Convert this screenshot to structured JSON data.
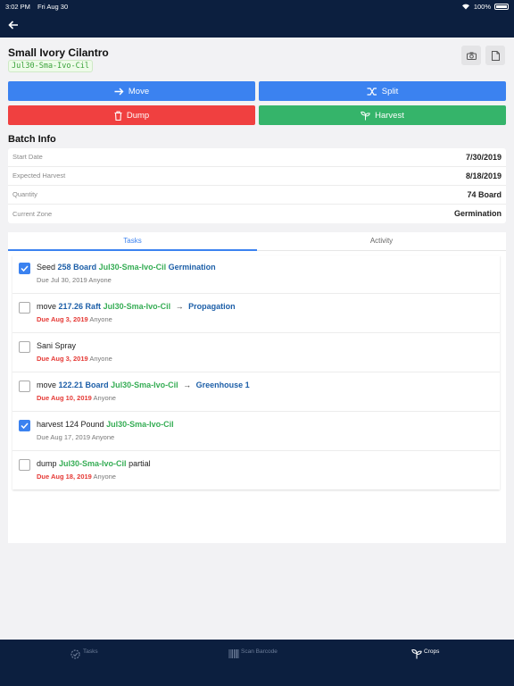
{
  "status": {
    "time": "3:02 PM",
    "date": "Fri Aug 30",
    "battery": "100%"
  },
  "header": {
    "title": "Small Ivory Cilantro",
    "code": "Jul30-Sma-Ivo-Cil"
  },
  "actions": {
    "move": "Move",
    "split": "Split",
    "dump": "Dump",
    "harvest": "Harvest"
  },
  "batch_info": {
    "title": "Batch Info",
    "rows": [
      {
        "label": "Start Date",
        "value": "7/30/2019"
      },
      {
        "label": "Expected Harvest",
        "value": "8/18/2019"
      },
      {
        "label": "Quantity",
        "value": "74 Board"
      },
      {
        "label": "Current Zone",
        "value": "Germination"
      }
    ]
  },
  "tabs": {
    "tasks": "Tasks",
    "activity": "Activity"
  },
  "tasks": [
    {
      "checked": true,
      "verb": "Seed",
      "qty": "258 Board",
      "code": "Jul30-Sma-Ivo-Cil",
      "arrow": "",
      "dest": "Germination",
      "suffix": "",
      "due": "Due Jul 30, 2019",
      "overdue": false,
      "assignee": "Anyone"
    },
    {
      "checked": false,
      "verb": "move",
      "qty": "217.26 Raft",
      "code": "Jul30-Sma-Ivo-Cil",
      "arrow": "→",
      "dest": "Propagation",
      "suffix": "",
      "due": "Due Aug 3, 2019",
      "overdue": true,
      "assignee": "Anyone"
    },
    {
      "checked": false,
      "verb": "Sani Spray",
      "qty": "",
      "code": "",
      "arrow": "",
      "dest": "",
      "suffix": "",
      "due": "Due Aug 3, 2019",
      "overdue": true,
      "assignee": "Anyone"
    },
    {
      "checked": false,
      "verb": "move",
      "qty": "122.21 Board",
      "code": "Jul30-Sma-Ivo-Cil",
      "arrow": "→",
      "dest": "Greenhouse 1",
      "suffix": "",
      "due": "Due Aug 10, 2019",
      "overdue": true,
      "assignee": "Anyone"
    },
    {
      "checked": true,
      "verb": "harvest 124 Pound",
      "qty": "",
      "code": "Jul30-Sma-Ivo-Cil",
      "arrow": "",
      "dest": "",
      "suffix": "",
      "due": "Due Aug 17, 2019",
      "overdue": false,
      "assignee": "Anyone"
    },
    {
      "checked": false,
      "verb": "dump",
      "qty": "",
      "code": "Jul30-Sma-Ivo-Cil",
      "arrow": "",
      "dest": "",
      "suffix": "partial",
      "due": "Due Aug 18, 2019",
      "overdue": true,
      "assignee": "Anyone"
    }
  ],
  "bottom_nav": {
    "tasks": "Tasks",
    "scan": "Scan Barcode",
    "crops": "Crops"
  },
  "colors": {
    "navy": "#0c1f3f",
    "blue": "#3b82f0",
    "red": "#f04040",
    "green": "#35b46a"
  }
}
